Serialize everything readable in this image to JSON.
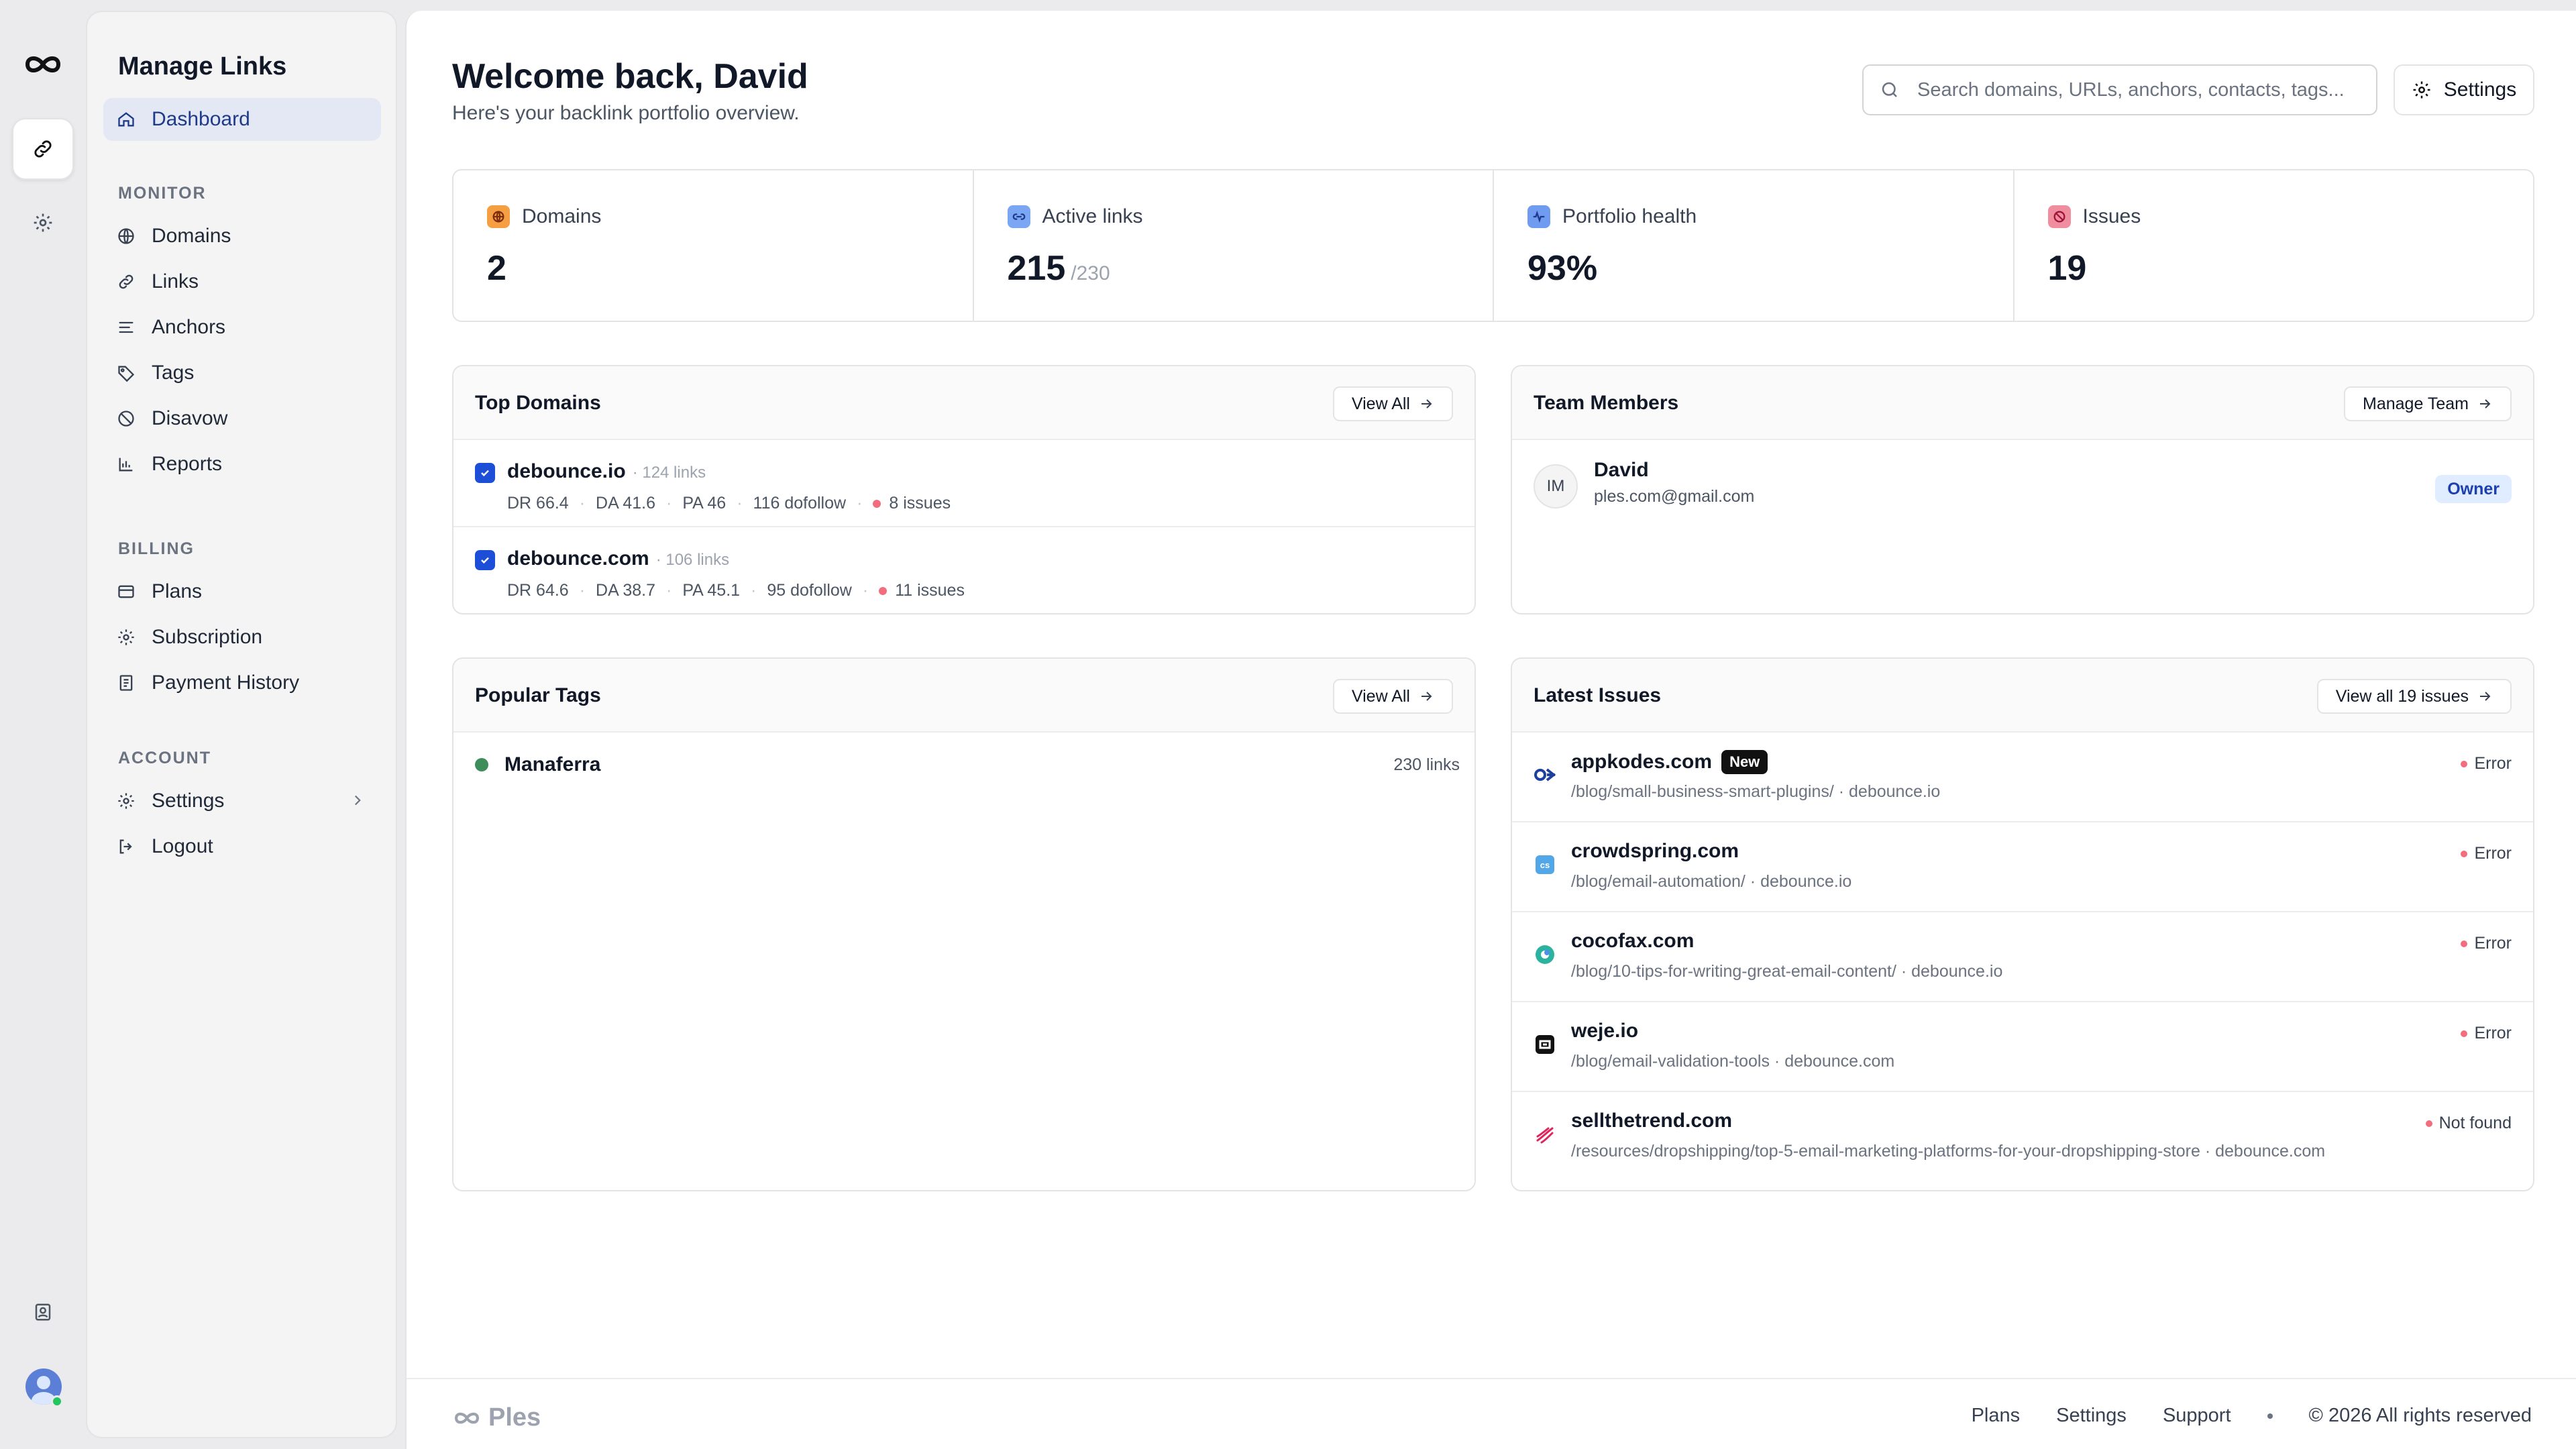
{
  "sidebar": {
    "title": "Manage Links",
    "dashboard": "Dashboard",
    "monitor_label": "MONITOR",
    "monitor": [
      "Domains",
      "Links",
      "Anchors",
      "Tags",
      "Disavow",
      "Reports"
    ],
    "billing_label": "BILLING",
    "billing": [
      "Plans",
      "Subscription",
      "Payment History"
    ],
    "account_label": "ACCOUNT",
    "settings": "Settings",
    "logout": "Logout"
  },
  "header": {
    "welcome": "Welcome back, David",
    "subtitle": "Here's your backlink portfolio overview.",
    "search_placeholder": "Search domains, URLs, anchors, contacts, tags...",
    "settings_button": "Settings"
  },
  "stats": [
    {
      "label": "Domains",
      "value": "2",
      "sub": ""
    },
    {
      "label": "Active links",
      "value": "215",
      "sub": "/230"
    },
    {
      "label": "Portfolio health",
      "value": "93%",
      "sub": ""
    },
    {
      "label": "Issues",
      "value": "19",
      "sub": ""
    }
  ],
  "top_domains": {
    "title": "Top Domains",
    "button": "View All",
    "items": [
      {
        "name": "debounce.io",
        "links": "· 124 links",
        "dr": "DR 66.4",
        "da": "DA 41.6",
        "pa": "PA 46",
        "dofollow": "116 dofollow",
        "issues": "8 issues"
      },
      {
        "name": "debounce.com",
        "links": "· 106 links",
        "dr": "DR 64.6",
        "da": "DA 38.7",
        "pa": "PA 45.1",
        "dofollow": "95 dofollow",
        "issues": "11 issues"
      }
    ]
  },
  "team": {
    "title": "Team Members",
    "button": "Manage Team",
    "member": {
      "initials": "IM",
      "name": "David",
      "email": "ples.com@gmail.com",
      "role": "Owner"
    }
  },
  "popular_tags": {
    "title": "Popular Tags",
    "button": "View All",
    "items": [
      {
        "name": "Manaferra",
        "count": "230 links",
        "color": "#3d8e5a"
      }
    ]
  },
  "latest_issues": {
    "title": "Latest Issues",
    "button": "View all 19 issues",
    "new_badge": "New",
    "items": [
      {
        "domain": "appkodes.com",
        "path": "/blog/small-business-smart-plugins/ · debounce.io",
        "status": "Error"
      },
      {
        "domain": "crowdspring.com",
        "path": "/blog/email-automation/ · debounce.io",
        "status": "Error"
      },
      {
        "domain": "cocofax.com",
        "path": "/blog/10-tips-for-writing-great-email-content/ · debounce.io",
        "status": "Error"
      },
      {
        "domain": "weje.io",
        "path": "/blog/email-validation-tools · debounce.com",
        "status": "Error"
      },
      {
        "domain": "sellthetrend.com",
        "path": "/resources/dropshipping/top-5-email-marketing-platforms-for-your-dropshipping-store · debounce.com",
        "status": "Not found"
      }
    ]
  },
  "footer": {
    "brand": "Ples",
    "links": [
      "Plans",
      "Settings",
      "Support"
    ],
    "copyright": "© 2026 All rights reserved"
  },
  "colors": {
    "accent": "#1d4ed8",
    "error_dot": "#f26d7d",
    "tag_green": "#3d8e5a",
    "active_nav_bg": "#e4e8f4"
  },
  "icons": {
    "rail": [
      "infinity-logo-icon",
      "link-icon",
      "gear-icon",
      "contacts-icon",
      "user-avatar-icon"
    ],
    "stats": [
      "globe-icon",
      "link-icon",
      "pulse-icon",
      "alert-icon"
    ]
  }
}
